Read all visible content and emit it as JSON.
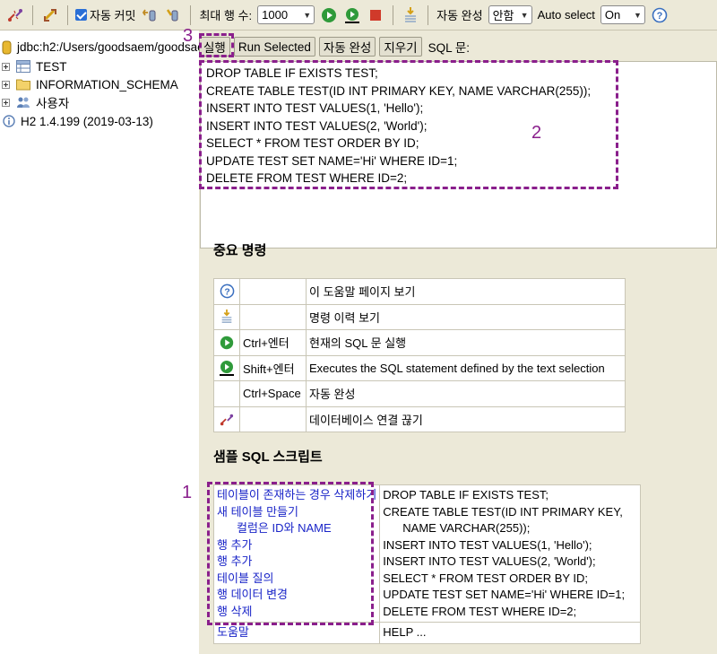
{
  "toolbar": {
    "autocommit_label": "자동 커밋",
    "max_rows_label": "최대 행 수:",
    "max_rows_value": "1000",
    "autocomplete_label": "자동 완성",
    "autocomplete_value": "안함",
    "autoselect_label": "Auto select",
    "autoselect_value": "On"
  },
  "tree": {
    "connection": "jdbc:h2:/Users/goodsaem/goodsaem",
    "items": [
      "TEST",
      "INFORMATION_SCHEMA",
      "사용자"
    ],
    "version": "H2 1.4.199 (2019-03-13)"
  },
  "buttons": {
    "run": "실행",
    "run_selected": "Run Selected",
    "autocomplete": "자동 완성",
    "clear": "지우기",
    "sql_label": "SQL 문:"
  },
  "sql_text": "DROP TABLE IF EXISTS TEST;\nCREATE TABLE TEST(ID INT PRIMARY KEY, NAME VARCHAR(255));\nINSERT INTO TEST VALUES(1, 'Hello');\nINSERT INTO TEST VALUES(2, 'World');\nSELECT * FROM TEST ORDER BY ID;\nUPDATE TEST SET NAME='Hi' WHERE ID=1;\nDELETE FROM TEST WHERE ID=2;",
  "important": {
    "title": "중요 명령",
    "rows": [
      {
        "icon": "help-icon",
        "key": "",
        "desc": "이 도움말 페이지 보기"
      },
      {
        "icon": "history-icon",
        "key": "",
        "desc": "명령 이력 보기"
      },
      {
        "icon": "run-icon",
        "key": "Ctrl+엔터",
        "desc": "현재의 SQL 문 실행"
      },
      {
        "icon": "run-selected-icon",
        "key": "Shift+엔터",
        "desc": "Executes the SQL statement defined by the text selection"
      },
      {
        "icon": "",
        "key": "Ctrl+Space",
        "desc": "자동 완성"
      },
      {
        "icon": "disconnect-icon",
        "key": "",
        "desc": "데이터베이스 연결 끊기"
      }
    ]
  },
  "samples": {
    "title": "샘플 SQL 스크립트",
    "links": [
      "테이블이 존재하는 경우 삭제하기",
      "새 테이블 만들기",
      "컬럼은 ID와 NAME",
      "행 추가",
      "행 추가",
      "테이블 질의",
      "행 데이터 변경",
      "행 삭제"
    ],
    "sql": [
      "DROP TABLE IF EXISTS TEST;",
      "CREATE TABLE TEST(ID INT PRIMARY KEY,",
      "NAME VARCHAR(255));",
      "INSERT INTO TEST VALUES(1, 'Hello');",
      "INSERT INTO TEST VALUES(2, 'World');",
      "SELECT * FROM TEST ORDER BY ID;",
      "UPDATE TEST SET NAME='Hi' WHERE ID=1;",
      "DELETE FROM TEST WHERE ID=2;"
    ],
    "help_link": "도움말",
    "help_sql": "HELP ..."
  },
  "annotations": {
    "one": "1",
    "two": "2",
    "three": "3"
  },
  "colors": {
    "annotation": "#8a1f8c",
    "link": "#1a25c8",
    "panel": "#ece9d8"
  }
}
